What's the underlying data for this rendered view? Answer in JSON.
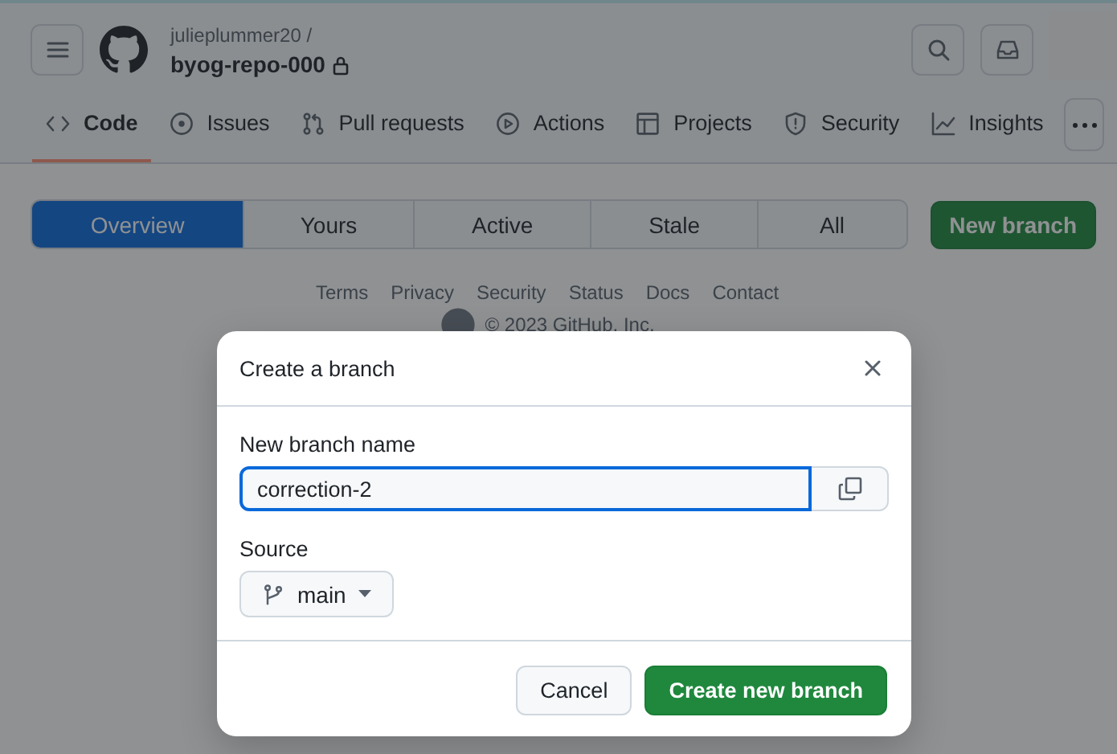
{
  "header": {
    "owner": "julieplummer20 /",
    "repo": "byog-repo-000",
    "private": true
  },
  "nav": [
    {
      "label": "Code",
      "selected": true
    },
    {
      "label": "Issues",
      "selected": false
    },
    {
      "label": "Pull requests",
      "selected": false
    },
    {
      "label": "Actions",
      "selected": false
    },
    {
      "label": "Projects",
      "selected": false
    },
    {
      "label": "Security",
      "selected": false
    },
    {
      "label": "Insights",
      "selected": false
    }
  ],
  "branch_tabs": [
    {
      "label": "Overview",
      "selected": true
    },
    {
      "label": "Yours",
      "selected": false
    },
    {
      "label": "Active",
      "selected": false
    },
    {
      "label": "Stale",
      "selected": false
    },
    {
      "label": "All",
      "selected": false
    }
  ],
  "new_branch_button": "New branch",
  "footer_links": [
    "Terms",
    "Privacy",
    "Security",
    "Status",
    "Docs",
    "Contact"
  ],
  "copyright": "© 2023 GitHub, Inc.",
  "dialog": {
    "title": "Create a branch",
    "name_label": "New branch name",
    "name_value": "correction-2",
    "source_label": "Source",
    "source_branch": "main",
    "buttons": [
      {
        "label": "Cancel",
        "kind": "secondary"
      },
      {
        "label": "Create new branch",
        "kind": "primary"
      }
    ]
  }
}
